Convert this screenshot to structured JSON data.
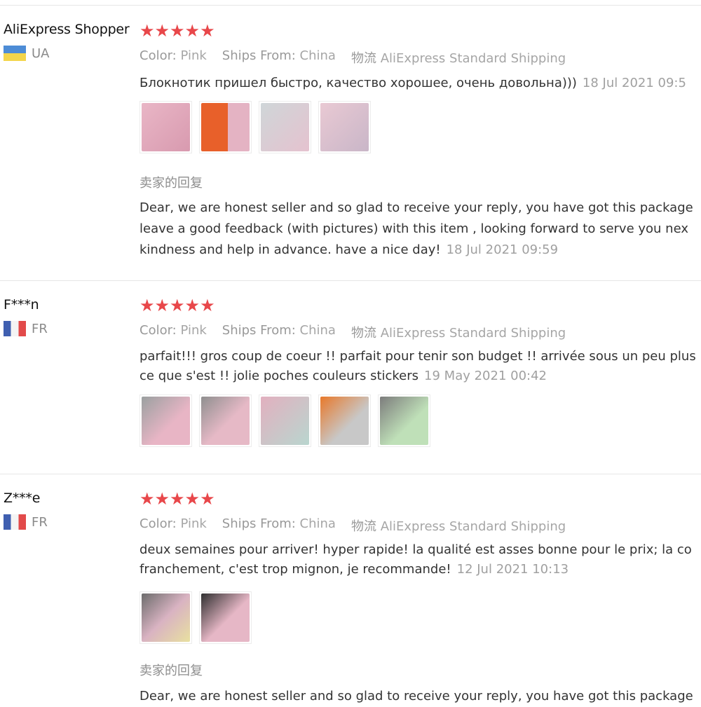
{
  "colors": {
    "star": "#e8474a",
    "text": "#333333",
    "muted": "#9a9a9a"
  },
  "reviews": [
    {
      "user": "AliExpress Shopper",
      "country": "UA",
      "stars": "★★★★★",
      "meta": {
        "color_label": "Color:",
        "color_value": "Pink",
        "ships_label": "Ships From:",
        "ships_value": "China",
        "ship_label": "物流",
        "ship_value": "AliExpress Standard Shipping"
      },
      "text": "Блокнотик пришел быстро, качество хорошее, очень довольна)))",
      "date": "18 Jul 2021 09:5",
      "images": [
        "photo-1",
        "photo-2",
        "photo-3",
        "photo-4"
      ],
      "seller_reply_label": "卖家的回复",
      "reply_lines": [
        "Dear, we are honest seller and so glad to receive your reply, you have got this package",
        "leave a good feedback (with pictures) with this item , looking forward to serve you nex",
        "kindness and help in advance. have a nice day!"
      ],
      "reply_date": "18 Jul 2021 09:59"
    },
    {
      "user": "F***n",
      "country": "FR",
      "stars": "★★★★★",
      "meta": {
        "color_label": "Color:",
        "color_value": "Pink",
        "ships_label": "Ships From:",
        "ships_value": "China",
        "ship_label": "物流",
        "ship_value": "AliExpress Standard Shipping"
      },
      "text_lines": [
        "parfait!!! gros coup de coeur !! parfait pour tenir son budget !! arrivée sous un peu plus",
        "ce que s'est !! jolie poches couleurs stickers"
      ],
      "date": "19 May 2021 00:42",
      "images": [
        "photo-1",
        "photo-2",
        "photo-3",
        "photo-4",
        "photo-5"
      ]
    },
    {
      "user": "Z***e",
      "country": "FR",
      "stars": "★★★★★",
      "meta": {
        "color_label": "Color:",
        "color_value": "Pink",
        "ships_label": "Ships From:",
        "ships_value": "China",
        "ship_label": "物流",
        "ship_value": "AliExpress Standard Shipping"
      },
      "text_lines": [
        "deux semaines pour arriver! hyper rapide! la qualité est asses bonne pour le prix; la co",
        "franchement, c'est trop mignon, je recommande!"
      ],
      "date": "12 Jul 2021 10:13",
      "images": [
        "photo-1",
        "photo-2"
      ],
      "seller_reply_label": "卖家的回复",
      "reply_lines": [
        "Dear, we are honest seller and so glad to receive your reply, you have got this package"
      ]
    }
  ]
}
